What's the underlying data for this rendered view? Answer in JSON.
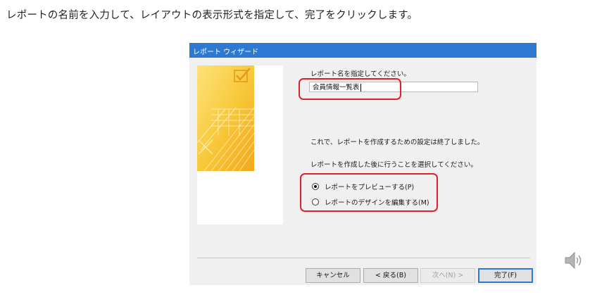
{
  "instruction": "レポートの名前を入力して、レイアウトの表示形式を指定して、完了をクリックします。",
  "dialog": {
    "title": "レポート ウィザード",
    "name_prompt": "レポート名を指定してください。",
    "report_name_value": "会員情報一覧表",
    "info_text": "これで、レポートを作成するための設定は終了しました。",
    "choose_text": "レポートを作成した後に行うことを選択してください。",
    "options": [
      {
        "label": "レポートをプレビューする(P)",
        "checked": true
      },
      {
        "label": "レポートのデザインを編集する(M)",
        "checked": false
      }
    ],
    "buttons": {
      "cancel": "キャンセル",
      "back": "< 戻る(B)",
      "next": "次へ(N) >",
      "finish": "完了(F)"
    }
  },
  "colors": {
    "titlebar": "#2b79d0",
    "highlight": "#e0202a",
    "accent_yellow": "#f5c93a"
  },
  "icons": [
    "report-wizard-graphic-icon",
    "speaker-icon"
  ]
}
